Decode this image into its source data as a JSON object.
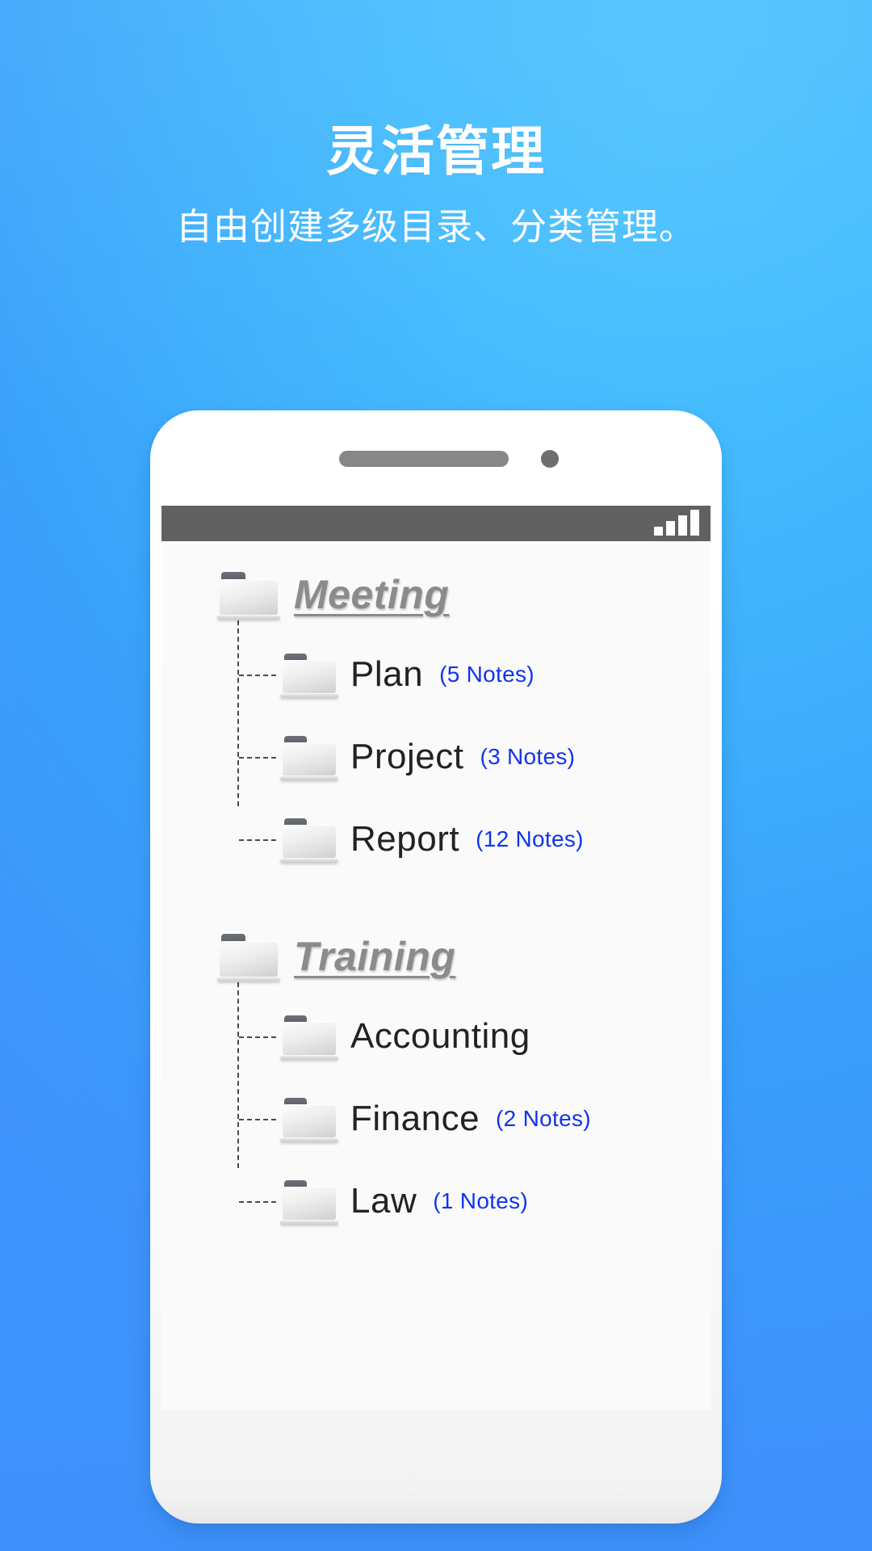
{
  "header": {
    "title": "灵活管理",
    "subtitle": "自由创建多级目录、分类管理。"
  },
  "colors": {
    "background_top": "#4fc3ff",
    "background_bottom": "#4094fb",
    "heading_text": "#ffffff",
    "status_bar": "#616161",
    "group_title": "#8b8b8b",
    "row_label": "#222222",
    "note_count": "#1133f0",
    "screen_background": "#fafafa"
  },
  "phone": {
    "speaker_icon": "speaker-grille",
    "camera_icon": "front-camera",
    "status_bar": {
      "signal_icon": "signal-bars-icon",
      "signal_bars": 4
    }
  },
  "tree": {
    "groups": [
      {
        "name": "Meeting",
        "folder_icon": "folder-icon",
        "children": [
          {
            "name": "Plan",
            "count": "(5 Notes)",
            "folder_icon": "folder-icon"
          },
          {
            "name": "Project",
            "count": "(3 Notes)",
            "folder_icon": "folder-icon"
          },
          {
            "name": "Report",
            "count": "(12 Notes)",
            "folder_icon": "folder-icon"
          }
        ]
      },
      {
        "name": "Training",
        "folder_icon": "folder-icon",
        "children": [
          {
            "name": "Accounting",
            "count": "",
            "folder_icon": "folder-icon"
          },
          {
            "name": "Finance",
            "count": "(2 Notes)",
            "folder_icon": "folder-icon"
          },
          {
            "name": "Law",
            "count": "(1 Notes)",
            "folder_icon": "folder-icon"
          }
        ]
      }
    ]
  }
}
